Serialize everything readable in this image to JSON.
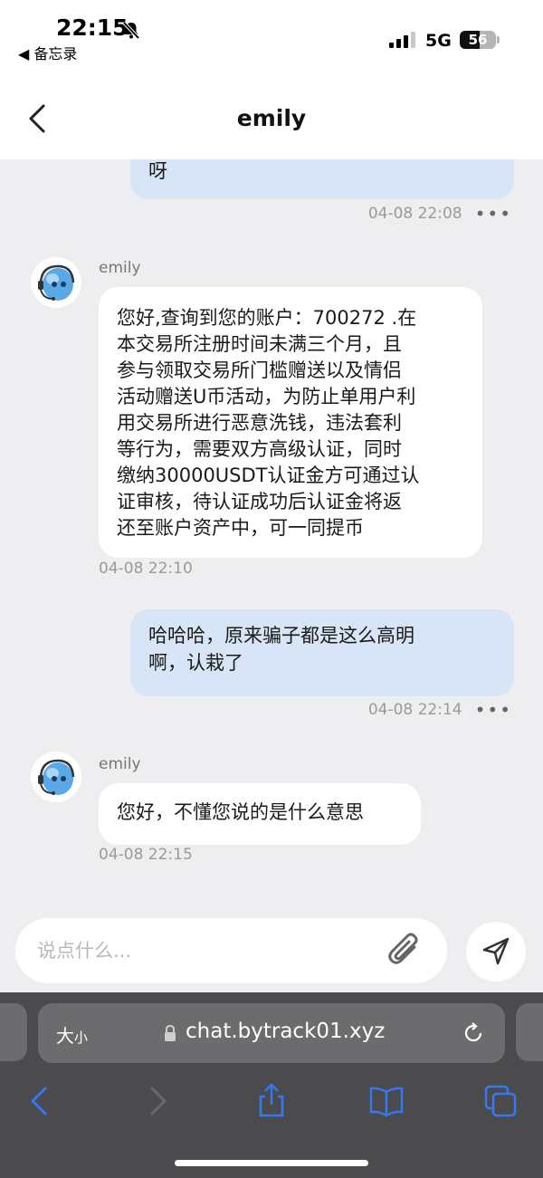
{
  "status_bar": {
    "time": "22:15",
    "back_app": "◀ 备忘录",
    "network": "5G",
    "battery_level": "56",
    "battery_fraction": 0.56
  },
  "header": {
    "back_icon": "chevron-left-icon",
    "title": "emily"
  },
  "messages": [
    {
      "direction": "out",
      "text": "呀",
      "time": "04-08 22:08"
    },
    {
      "direction": "in",
      "sender": "emily",
      "lines": [
        "您好,查询到您的账户：700272 .在",
        "本交易所注册时间未满三个月，且",
        "参与领取交易所门槛赠送以及情侣",
        "活动赠送U币活动，为防止单用户利",
        "用交易所进行恶意洗钱，违法套利",
        "等行为，需要双方高级认证，同时",
        "缴纳30000USDT认证金方可通过认",
        "证审核，待认证成功后认证金将返",
        "还至账户资产中，可一同提币"
      ],
      "time": "04-08 22:10"
    },
    {
      "direction": "out",
      "lines": [
        "哈哈哈，原来骗子都是这么高明",
        "啊，认栽了"
      ],
      "time": "04-08 22:14"
    },
    {
      "direction": "in",
      "sender": "emily",
      "text": "您好，不懂您说的是什么意思",
      "time": "04-08 22:15"
    }
  ],
  "more_label": "•••",
  "input": {
    "placeholder": "说点什么...",
    "attach_icon": "paperclip-icon",
    "send_icon": "send-icon"
  },
  "browser": {
    "text_size": "大",
    "text_size_small": "小",
    "url": "chat.bytrack01.xyz",
    "toolbar_icons": [
      "back-icon",
      "forward-icon",
      "share-icon",
      "bookmarks-icon",
      "tabs-icon"
    ]
  },
  "colors": {
    "accent": "#3478f6",
    "outgoing_bubble": "#d8e5f6",
    "incoming_bubble": "#ffffff",
    "chat_bg": "#eeeef1"
  }
}
